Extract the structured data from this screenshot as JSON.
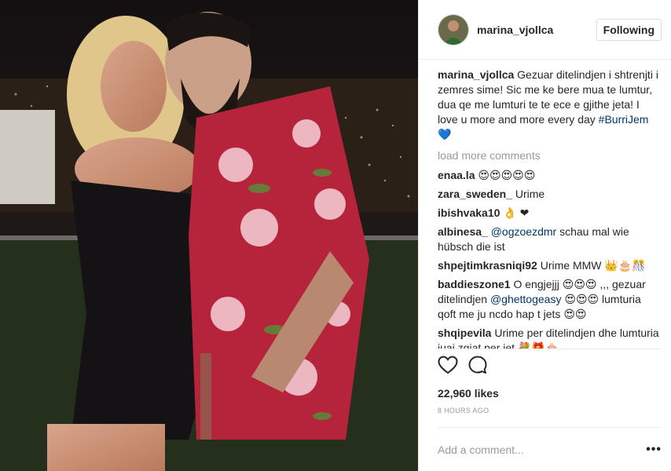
{
  "header": {
    "username": "marina_vjollca",
    "follow_label": "Following"
  },
  "caption": {
    "author": "marina_vjollca",
    "text": "Gezuar ditelindjen i shtrenjti i zemres sime! Sic me ke bere mua te lumtur, dua qe me lumturi te te ece e gjithe jeta! I love u more and more every day",
    "hashtag": "#BurriJem",
    "heart": "💙"
  },
  "load_more": "load more comments",
  "comments": [
    {
      "user": "enaa.la",
      "pre": "😍😍😍😍😍",
      "mention": "",
      "post": ""
    },
    {
      "user": "zara_sweden_",
      "pre": "Urime",
      "mention": "",
      "post": ""
    },
    {
      "user": "ibishvaka10",
      "pre": "👌 ❤",
      "mention": "",
      "post": ""
    },
    {
      "user": "albinesa_",
      "pre": "",
      "mention": "@ogzoezdmr",
      "post": "schau mal wie hübsch die ist"
    },
    {
      "user": "shpejtimkrasniqi92",
      "pre": "Urime MMW 👑🎂🎊",
      "mention": "",
      "post": ""
    },
    {
      "user": "baddieszone1",
      "pre": "O engjejjj 😍😍😍 ,,, gezuar ditelindjen",
      "mention": "@ghettogeasy",
      "post": "😍😍😍 lumturia qoft me ju ncdo hap t jets 😍😍"
    },
    {
      "user": "shqipevila",
      "pre": "Urime per ditelindjen dhe lumturia juaj zgjat per jet 💐🎁🎂",
      "mention": "",
      "post": ""
    }
  ],
  "actions": {
    "like_icon": "heart-icon",
    "comment_icon": "comment-icon",
    "likes": "22,960 likes",
    "timestamp": "8 HOURS AGO"
  },
  "add_comment": {
    "placeholder": "Add a comment...",
    "more_label": "•••"
  },
  "colors": {
    "link": "#003569",
    "muted": "#999999",
    "border": "#efefef",
    "text": "#262626"
  }
}
